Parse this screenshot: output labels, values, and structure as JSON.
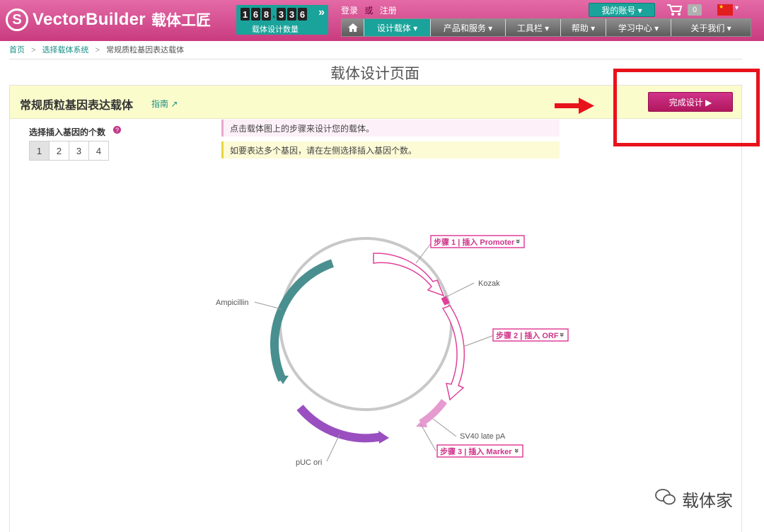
{
  "header": {
    "logo_mark": "S",
    "logo_text": "VectorBuilder",
    "logo_cn": "载体工匠",
    "counter_digits": [
      "1",
      "6",
      "8",
      ",",
      "3",
      "3",
      "6"
    ],
    "counter_arrow": "»",
    "counter_label": "载体设计数量",
    "login": "登录",
    "or": "或",
    "register": "注册",
    "account": "我的账号 ▾",
    "cart_count": "0",
    "nav": [
      "设计载体 ▾",
      "产品和服务 ▾",
      "工具栏 ▾",
      "帮助 ▾",
      "学习中心 ▾",
      "关于我们 ▾"
    ]
  },
  "breadcrumb": {
    "home": "首页",
    "sep": ">",
    "system": "选择载体系统",
    "current": "常规质粒基因表达载体"
  },
  "page_title": "载体设计页面",
  "panel": {
    "vector_title": "常规质粒基因表达载体",
    "guide": "指南 ↗",
    "finish_button": "完成设计 ▶",
    "insert_label": "选择插入基因的个数",
    "help": "?",
    "numbers": [
      "1",
      "2",
      "3",
      "4"
    ],
    "msg_click": "点击载体图上的步骤来设计您的载体。",
    "msg_multi": "如要表达多个基因，请在左侧选择插入基因个数。"
  },
  "map": {
    "step1": "步骤 1 | 插入 Promoter",
    "step2": "步骤 2 | 插入 ORF",
    "step3": "步骤 3 | 插入 Marker",
    "kozak": "Kozak",
    "ampicillin": "Ampicillin",
    "sv40": "SV40 late pA",
    "puc": "pUC ori",
    "chev": "»"
  },
  "colors": {
    "brand_pink": "#d0338a",
    "teal": "#1aa39a",
    "amp": "#4a8f8f",
    "puc": "#9a4fc0",
    "marker": "#e59ad0",
    "highlight": "#e8121b"
  },
  "watermark": "载体家"
}
